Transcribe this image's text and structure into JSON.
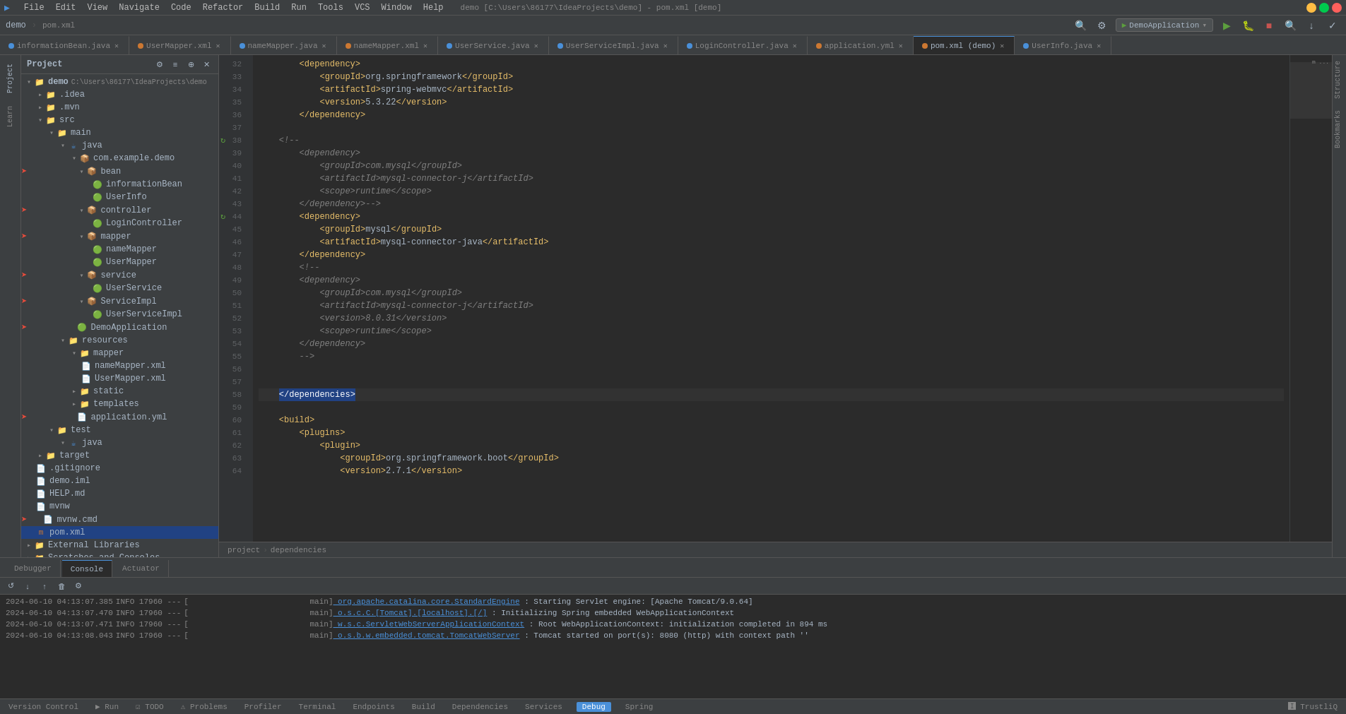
{
  "window": {
    "title": "demo [C:\\Users\\86177\\IdeaProjects\\demo] - pom.xml [demo]",
    "menu_items": [
      "File",
      "Edit",
      "View",
      "Navigate",
      "Code",
      "Refactor",
      "Build",
      "Run",
      "Tools",
      "VCS",
      "Window",
      "Help"
    ]
  },
  "title_bar": {
    "project": "demo",
    "path": "pom.xml",
    "run_config": "DemoApplication"
  },
  "tabs": [
    {
      "label": "informationBean.java",
      "active": false,
      "dot": "blue"
    },
    {
      "label": "UserMapper.xml",
      "active": false,
      "dot": "orange"
    },
    {
      "label": "nameMapper.java",
      "active": false,
      "dot": "blue"
    },
    {
      "label": "nameMapper.xml",
      "active": false,
      "dot": "orange"
    },
    {
      "label": "UserService.java",
      "active": false,
      "dot": "blue"
    },
    {
      "label": "UserServiceImpl.java",
      "active": false,
      "dot": "blue"
    },
    {
      "label": "LoginController.java",
      "active": false,
      "dot": "blue"
    },
    {
      "label": "application.yml",
      "active": false,
      "dot": "orange"
    },
    {
      "label": "pom.xml (demo)",
      "active": true,
      "dot": "orange"
    },
    {
      "label": "UserInfo.java",
      "active": false,
      "dot": "blue"
    }
  ],
  "project_tree": [
    {
      "level": 0,
      "expanded": true,
      "label": "demo C:\\Users\\86177\\IdeaProjects\\demo",
      "type": "project",
      "arrow": "▾"
    },
    {
      "level": 1,
      "expanded": false,
      "label": ".idea",
      "type": "folder",
      "arrow": "▸"
    },
    {
      "level": 1,
      "expanded": false,
      "label": ".mvn",
      "type": "folder",
      "arrow": "▸"
    },
    {
      "level": 1,
      "expanded": true,
      "label": "src",
      "type": "folder",
      "arrow": "▾"
    },
    {
      "level": 2,
      "expanded": true,
      "label": "main",
      "type": "folder",
      "arrow": "▾"
    },
    {
      "level": 3,
      "expanded": true,
      "label": "java",
      "type": "folder",
      "arrow": "▾"
    },
    {
      "level": 4,
      "expanded": true,
      "label": "com.example.demo",
      "type": "package",
      "arrow": "▾"
    },
    {
      "level": 5,
      "expanded": true,
      "label": "bean",
      "type": "package",
      "arrow": "▾",
      "hasArrow": true
    },
    {
      "level": 6,
      "expanded": false,
      "label": "informationBean",
      "type": "class",
      "arrow": ""
    },
    {
      "level": 6,
      "expanded": false,
      "label": "UserInfo",
      "type": "class",
      "arrow": ""
    },
    {
      "level": 5,
      "expanded": true,
      "label": "controller",
      "type": "package",
      "arrow": "▾",
      "hasArrow": true
    },
    {
      "level": 6,
      "expanded": false,
      "label": "LoginController",
      "type": "class",
      "arrow": ""
    },
    {
      "level": 5,
      "expanded": true,
      "label": "mapper",
      "type": "package",
      "arrow": "▾",
      "hasArrow": true
    },
    {
      "level": 6,
      "expanded": false,
      "label": "nameMapper",
      "type": "class",
      "arrow": ""
    },
    {
      "level": 6,
      "expanded": false,
      "label": "UserMapper",
      "type": "class",
      "arrow": ""
    },
    {
      "level": 5,
      "expanded": true,
      "label": "service",
      "type": "package",
      "arrow": "▾",
      "hasArrow": true
    },
    {
      "level": 6,
      "expanded": false,
      "label": "UserService",
      "type": "class",
      "arrow": ""
    },
    {
      "level": 5,
      "expanded": true,
      "label": "ServiceImpl",
      "type": "package",
      "arrow": "▾",
      "hasArrow": true
    },
    {
      "level": 6,
      "expanded": false,
      "label": "UserServiceImpl",
      "type": "class",
      "arrow": ""
    },
    {
      "level": 5,
      "expanded": false,
      "label": "DemoApplication",
      "type": "class",
      "arrow": "",
      "hasArrow": true
    },
    {
      "level": 3,
      "expanded": true,
      "label": "resources",
      "type": "folder",
      "arrow": "▾"
    },
    {
      "level": 4,
      "expanded": true,
      "label": "mapper",
      "type": "folder",
      "arrow": "▾"
    },
    {
      "level": 5,
      "expanded": false,
      "label": "nameMapper.xml",
      "type": "xml",
      "arrow": ""
    },
    {
      "level": 5,
      "expanded": false,
      "label": "UserMapper.xml",
      "type": "xml",
      "arrow": ""
    },
    {
      "level": 4,
      "expanded": false,
      "label": "static",
      "type": "folder",
      "arrow": "▸"
    },
    {
      "level": 4,
      "expanded": false,
      "label": "templates",
      "type": "folder",
      "arrow": "▸"
    },
    {
      "level": 4,
      "expanded": false,
      "label": "application.yml",
      "type": "yml",
      "arrow": "",
      "hasArrow": true
    },
    {
      "level": 2,
      "expanded": true,
      "label": "test",
      "type": "folder",
      "arrow": "▾"
    },
    {
      "level": 3,
      "expanded": true,
      "label": "java",
      "type": "folder",
      "arrow": "▾"
    },
    {
      "level": 1,
      "expanded": false,
      "label": "target",
      "type": "folder",
      "arrow": "▸"
    },
    {
      "level": 1,
      "expanded": false,
      "label": ".gitignore",
      "type": "txt",
      "arrow": ""
    },
    {
      "level": 1,
      "expanded": false,
      "label": "demo.iml",
      "type": "txt",
      "arrow": ""
    },
    {
      "level": 1,
      "expanded": false,
      "label": "HELP.md",
      "type": "md",
      "arrow": ""
    },
    {
      "level": 1,
      "expanded": false,
      "label": "mvnw",
      "type": "txt",
      "arrow": ""
    },
    {
      "level": 1,
      "expanded": false,
      "label": "mvnw.cmd",
      "type": "txt",
      "arrow": "",
      "hasArrow": true
    },
    {
      "level": 1,
      "expanded": false,
      "label": "pom.xml",
      "type": "pom",
      "arrow": "",
      "selected": true
    }
  ],
  "code_lines": [
    {
      "num": 32,
      "content": "        <dependency>",
      "type": "tag",
      "icon": null
    },
    {
      "num": 33,
      "content": "            <groupId>org.springframework</groupId>",
      "type": "tag"
    },
    {
      "num": 34,
      "content": "            <artifactId>spring-webmvc</artifactId>",
      "type": "tag"
    },
    {
      "num": 35,
      "content": "            <version>5.3.22</version>",
      "type": "tag"
    },
    {
      "num": 36,
      "content": "        </dependency>",
      "type": "tag"
    },
    {
      "num": 37,
      "content": "",
      "type": "empty"
    },
    {
      "num": 38,
      "content": "    <!--",
      "type": "comment",
      "icon": "sync"
    },
    {
      "num": 39,
      "content": "        <dependency>",
      "type": "comment"
    },
    {
      "num": 40,
      "content": "            <groupId>com.mysql</groupId>",
      "type": "comment"
    },
    {
      "num": 41,
      "content": "            <artifactId>mysql-connector-j</artifactId>",
      "type": "comment"
    },
    {
      "num": 42,
      "content": "            <scope>runtime</scope>",
      "type": "comment"
    },
    {
      "num": 43,
      "content": "        </dependency>-->",
      "type": "comment"
    },
    {
      "num": 44,
      "content": "        <dependency>",
      "type": "tag",
      "icon": "sync"
    },
    {
      "num": 45,
      "content": "            <groupId>mysql</groupId>",
      "type": "tag"
    },
    {
      "num": 46,
      "content": "            <artifactId>mysql-connector-java</artifactId>",
      "type": "tag"
    },
    {
      "num": 47,
      "content": "        </dependency>",
      "type": "tag"
    },
    {
      "num": 48,
      "content": "        <!--",
      "type": "comment"
    },
    {
      "num": 49,
      "content": "        <dependency>",
      "type": "comment"
    },
    {
      "num": 50,
      "content": "            <groupId>com.mysql</groupId>",
      "type": "comment"
    },
    {
      "num": 51,
      "content": "            <artifactId>mysql-connector-j</artifactId>",
      "type": "comment"
    },
    {
      "num": 52,
      "content": "            <version>8.0.31</version>",
      "type": "comment"
    },
    {
      "num": 53,
      "content": "            <scope>runtime</scope>",
      "type": "comment"
    },
    {
      "num": 54,
      "content": "        </dependency>",
      "type": "comment"
    },
    {
      "num": 55,
      "content": "        -->",
      "type": "comment"
    },
    {
      "num": 56,
      "content": "",
      "type": "empty"
    },
    {
      "num": 57,
      "content": "",
      "type": "empty"
    },
    {
      "num": 58,
      "content": "    </dependencies>",
      "type": "tag_selected"
    },
    {
      "num": 59,
      "content": "",
      "type": "empty"
    },
    {
      "num": 60,
      "content": "    <build>",
      "type": "tag"
    },
    {
      "num": 61,
      "content": "        <plugins>",
      "type": "tag"
    },
    {
      "num": 62,
      "content": "            <plugin>",
      "type": "tag"
    },
    {
      "num": 63,
      "content": "                <groupId>org.springframework.boot</groupId>",
      "type": "tag"
    },
    {
      "num": 64,
      "content": "                <version>2.7.1</version>",
      "type": "tag"
    }
  ],
  "breadcrumb": {
    "project": "project",
    "separator": "›",
    "node": "dependencies"
  },
  "bottom_tabs": [
    {
      "label": "Debugger",
      "active": false
    },
    {
      "label": "Console",
      "active": true
    },
    {
      "label": "Actuator",
      "active": false
    }
  ],
  "log_entries": [
    {
      "date": "2024-06-10 04:13:07.385",
      "level": "INFO",
      "thread": "17960",
      "dashes": "---",
      "bracket": "[                          main]",
      "class": "org.apache.catalina.core.StandardEngine",
      "msg": " : Starting Servlet engine: [Apache Tomcat/9.0.64]"
    },
    {
      "date": "2024-06-10 04:13:07.470",
      "level": "INFO",
      "thread": "17960",
      "dashes": "---",
      "bracket": "[                          main]",
      "class": "o.s.c.C.[Tomcat].[localhost].[/]",
      "msg": " : Initializing Spring embedded WebApplicationContext"
    },
    {
      "date": "2024-06-10 04:13:07.471",
      "level": "INFO",
      "thread": "17960",
      "dashes": "---",
      "bracket": "[                          main]",
      "class": "w.s.c.ServletWebServerApplicationContext",
      "msg": " : Root WebApplicationContext: initialization completed in 894 ms"
    },
    {
      "date": "2024-06-10 04:13:08.043",
      "level": "INFO",
      "thread": "17960",
      "dashes": "---",
      "bracket": "[                          main]",
      "class": "o.s.b.w.embedded.tomcat.TomcatWebServer",
      "msg": " : Tomcat started on port(s): 8080 (http) with context path ''"
    }
  ],
  "status_bar": {
    "version_control": "Version Control",
    "run": "▶ Run",
    "todo": "☑ TODO",
    "problems": "⚠ Problems",
    "profiler": "Profiler",
    "terminal": "Terminal",
    "endpoints": "Endpoints",
    "build": "Build",
    "dependencies": "Dependencies",
    "services": "Services",
    "debug": "Debug",
    "spring": "Spring",
    "right_info": "🅸 TrustliQ"
  },
  "right_panel_tabs": [
    "Structure",
    "Bookmarks"
  ],
  "left_panel_tabs": [
    "Project",
    "Learn"
  ]
}
